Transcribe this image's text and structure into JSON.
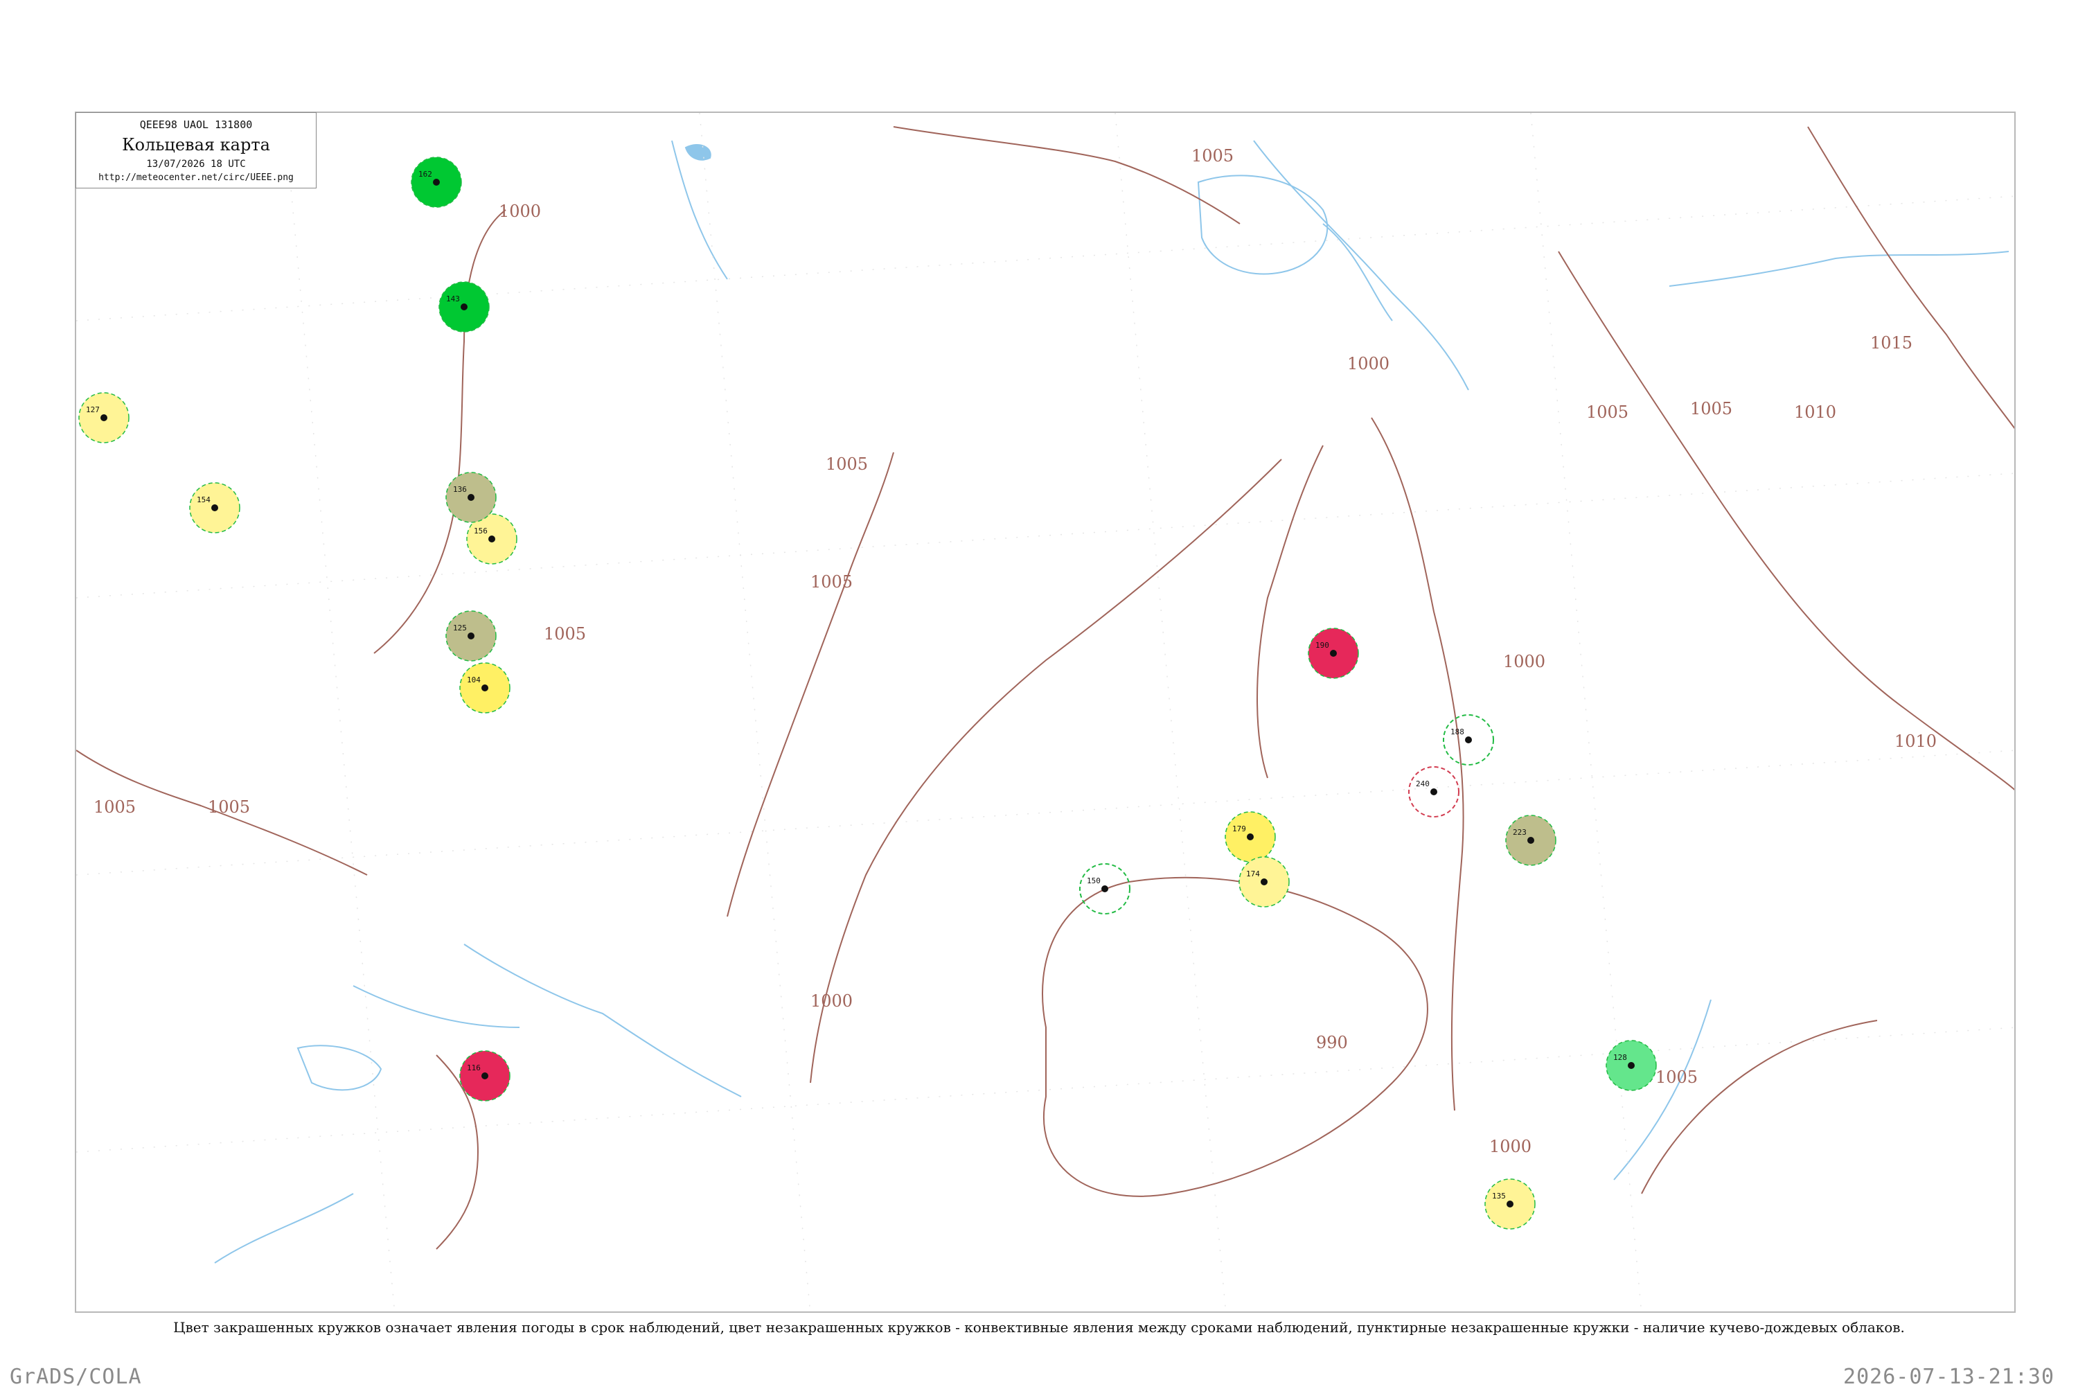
{
  "header": {
    "code_line": "QEEE98  UAOL  131800",
    "title": "Кольцевая карта",
    "date": "13/07/2026 18 UTC",
    "url": "http://meteocenter.net/circ/UEEE.png"
  },
  "caption": "Цвет закрашенных кружков означает явления погоды в срок наблюдений, цвет незакрашенных кружков - конвективные явления между сроками наблюдений, пунктирные незакрашенные кружки - наличие кучево-дождевых облаков.",
  "footer": {
    "left": "GrADS/COLA",
    "right": "2026-07-13-21:30"
  },
  "colors": {
    "isobar": "#a0645a",
    "water": "#8ec6ea",
    "land": "#ffffff",
    "frame": "#b8b8b8",
    "fill_green": "#00c832",
    "fill_yellow": "#fff064",
    "fill_pale_yellow": "#fff496",
    "fill_red": "#e6285a",
    "fill_olive": "#bebe8c",
    "fill_light_green": "#64e68c",
    "ring_green": "#22bb44",
    "ring_red": "#d23c50"
  },
  "isobar_labels": [
    "1005",
    "1000",
    "1005",
    "1005",
    "1000",
    "1005",
    "1005",
    "1000",
    "1000",
    "1005",
    "1010",
    "1015",
    "1010",
    "990",
    "1000",
    "1005",
    "1005",
    "1005"
  ],
  "stations": [
    {
      "num": "162",
      "name": "",
      "weather": "fill_green"
    },
    {
      "num": "143",
      "name": "",
      "weather": "fill_green"
    },
    {
      "num": "154",
      "name": "",
      "weather": "fill_pale_yellow"
    },
    {
      "num": "127",
      "name": "",
      "weather": "fill_pale_yellow"
    },
    {
      "num": "156",
      "name": "",
      "weather": "fill_pale_yellow"
    },
    {
      "num": "136",
      "name": "",
      "weather": "fill_olive"
    },
    {
      "num": "125",
      "name": "",
      "weather": "fill_olive"
    },
    {
      "num": "104",
      "name": "",
      "weather": "fill_yellow"
    },
    {
      "num": "116",
      "name": "",
      "weather": "fill_red"
    },
    {
      "num": "190",
      "name": "",
      "weather": "fill_red"
    },
    {
      "num": "179",
      "name": "",
      "weather": "fill_yellow"
    },
    {
      "num": "174",
      "name": "",
      "weather": "fill_pale_yellow"
    },
    {
      "num": "223",
      "name": "",
      "weather": "fill_olive"
    },
    {
      "num": "128",
      "name": "",
      "weather": "fill_light_green"
    },
    {
      "num": "135",
      "name": "",
      "weather": "fill_pale_yellow"
    },
    {
      "num": "240",
      "name": "",
      "weather": "ring_red"
    },
    {
      "num": "188",
      "name": "",
      "weather": "ring_green"
    },
    {
      "num": "150",
      "name": "",
      "weather": "ring_green"
    }
  ]
}
